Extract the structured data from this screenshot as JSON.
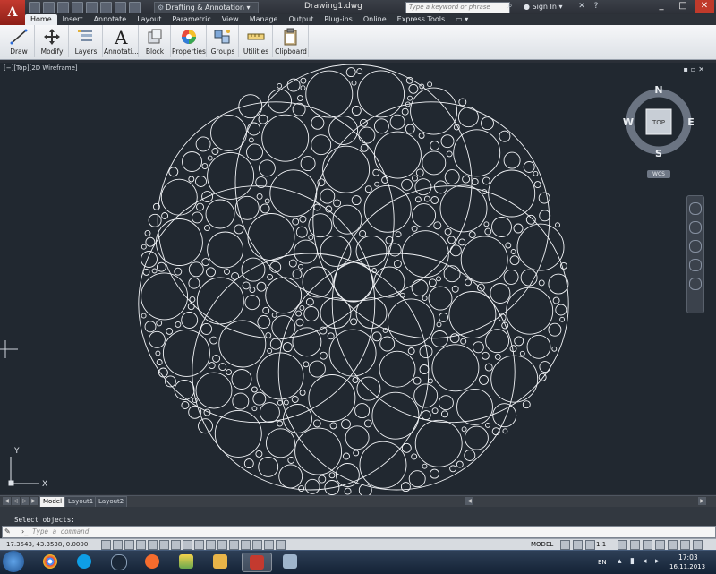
{
  "window": {
    "app_logo": "A",
    "workspace": "Drafting & Annotation",
    "document_title": "Drawing1.dwg",
    "search_placeholder": "Type a keyword or phrase",
    "sign_in": "Sign In"
  },
  "tabs": [
    "Home",
    "Insert",
    "Annotate",
    "Layout",
    "Parametric",
    "View",
    "Manage",
    "Output",
    "Plug-ins",
    "Online",
    "Express Tools"
  ],
  "active_tab": "Home",
  "ribbon": {
    "panels": [
      "Draw",
      "Modify",
      "Layers",
      "Annotati...",
      "Block",
      "Properties",
      "Groups",
      "Utilities",
      "Clipboard"
    ]
  },
  "viewport": {
    "label": "[−][Top][2D Wireframe]",
    "viewcube": {
      "face": "TOP",
      "north": "N",
      "south": "S",
      "east": "E",
      "west": "W",
      "wcs": "WCS"
    },
    "ucs": {
      "x": "X",
      "y": "Y"
    }
  },
  "layout_tabs": [
    "Model",
    "Layout1",
    "Layout2"
  ],
  "active_layout": "Model",
  "command": {
    "history": "Select objects:",
    "placeholder": "Type a command"
  },
  "status": {
    "coordinates": "17.3543, 43.3538, 0.0000",
    "mode": "MODEL",
    "scale": "1:1"
  },
  "taskbar": {
    "language": "EN",
    "time": "17:03",
    "date": "16.11.2013"
  },
  "colors": {
    "viewport_bg": "#212830",
    "drawing_lines": "#f2f4f7",
    "app_red": "#c43a2f"
  }
}
